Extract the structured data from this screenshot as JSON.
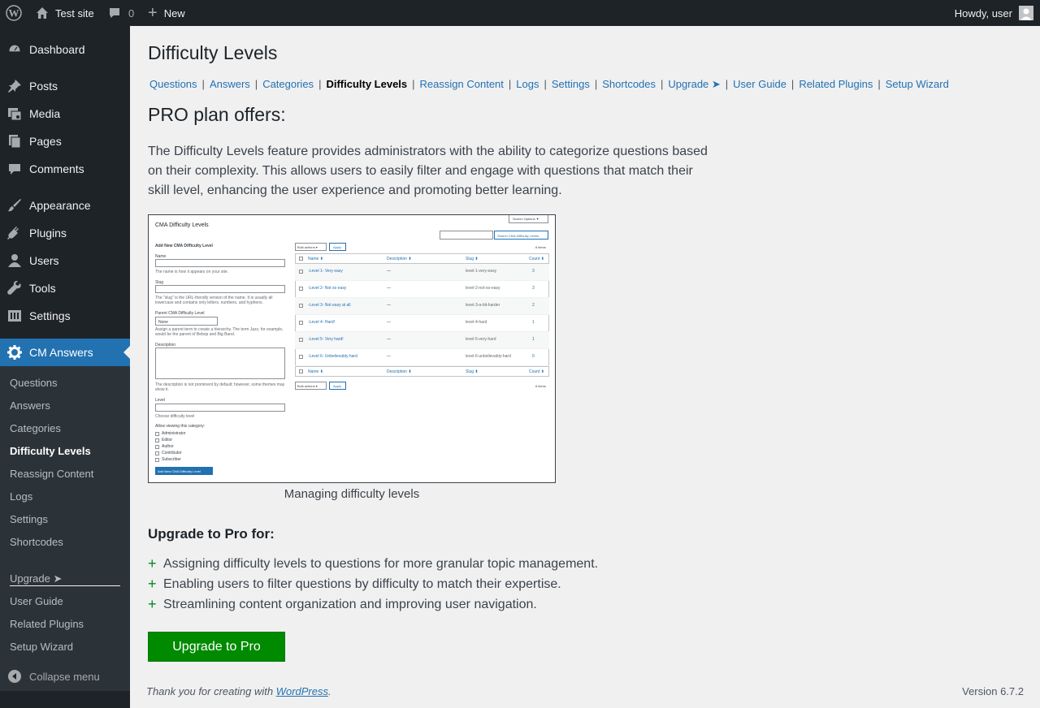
{
  "adminbar": {
    "site_name": "Test site",
    "comments_count": "0",
    "new_label": "New",
    "howdy": "Howdy, user"
  },
  "sidebar": {
    "items": [
      {
        "label": "Dashboard",
        "icon": "dashboard-icon"
      },
      {
        "label": "Posts",
        "icon": "pin-icon"
      },
      {
        "label": "Media",
        "icon": "media-icon"
      },
      {
        "label": "Pages",
        "icon": "pages-icon"
      },
      {
        "label": "Comments",
        "icon": "comment-icon"
      },
      {
        "label": "Appearance",
        "icon": "brush-icon"
      },
      {
        "label": "Plugins",
        "icon": "plug-icon"
      },
      {
        "label": "Users",
        "icon": "user-icon"
      },
      {
        "label": "Tools",
        "icon": "wrench-icon"
      },
      {
        "label": "Settings",
        "icon": "settings-icon"
      },
      {
        "label": "CM Answers",
        "icon": "gear-icon"
      }
    ],
    "submenu": [
      "Questions",
      "Answers",
      "Categories",
      "Difficulty Levels",
      "Reassign Content",
      "Logs",
      "Settings",
      "Shortcodes"
    ],
    "submenu2": [
      "Upgrade ➤",
      "User Guide",
      "Related Plugins",
      "Setup Wizard"
    ],
    "collapse": "Collapse menu"
  },
  "main": {
    "title": "Difficulty Levels",
    "tabs": [
      "Questions",
      "Answers",
      "Categories",
      "Difficulty Levels",
      "Reassign Content",
      "Logs",
      "Settings",
      "Shortcodes",
      "Upgrade ➤",
      "User Guide",
      "Related Plugins",
      "Setup Wizard"
    ],
    "offers_title": "PRO plan offers:",
    "description": "The Difficulty Levels feature provides administrators with the ability to categorize questions based on their complexity. This allows users to easily filter and engage with questions that match their skill level, enhancing the user experience and promoting better learning.",
    "caption": "Managing difficulty levels",
    "upgrade_heading": "Upgrade to Pro for:",
    "features": [
      "Assigning difficulty levels to questions for more granular topic management.",
      "Enabling users to filter questions by difficulty to match their expertise.",
      "Streamlining content organization and improving user navigation."
    ],
    "upgrade_button": "Upgrade to Pro"
  },
  "screenshot": {
    "title": "CMA Difficulty Levels",
    "screen_options": "Screen Options ▼",
    "search_button": "Search CMA Difficulty Levels",
    "add_new_heading": "Add New CMA Difficulty Level",
    "name_label": "Name",
    "name_help": "The name is how it appears on your site.",
    "slug_label": "Slug",
    "slug_help": "The \"slug\" is the URL-friendly version of the name. It is usually all lowercase and contains only letters, numbers, and hyphens.",
    "parent_label": "Parent CMA Difficulty Level",
    "parent_value": "None",
    "parent_help": "Assign a parent term to create a hierarchy. The term Jazz, for example, would be the parent of Bebop and Big Band.",
    "description_label": "Description",
    "description_help": "The description is not prominent by default; however, some themes may show it.",
    "level_label": "Level",
    "level_help": "Choose difficulty level",
    "roles_label": "Allow viewing this category:",
    "roles": [
      "Administrator",
      "Editor",
      "Author",
      "Contributor",
      "Subscriber"
    ],
    "add_button": "Add New CMA Difficulty Level",
    "bulk_actions": "Bulk actions ▾",
    "apply": "Apply",
    "items_count": "6 items",
    "columns": [
      "Name ⬍",
      "Description ⬍",
      "Slug ⬍",
      "Count ⬍"
    ],
    "rows": [
      {
        "name": "-Level 1- Very easy",
        "desc": "—",
        "slug": "level-1-very-easy",
        "count": "3"
      },
      {
        "name": "-Level 2- Not so easy",
        "desc": "—",
        "slug": "level-2-not-so-easy",
        "count": "3"
      },
      {
        "name": "-Level 3- Not easy at all",
        "desc": "—",
        "slug": "level-3-a-bit-harder",
        "count": "2"
      },
      {
        "name": "-Level 4- Hard!",
        "desc": "—",
        "slug": "level-4-hard",
        "count": "1"
      },
      {
        "name": "-Level 5- Very hard!",
        "desc": "—",
        "slug": "level-5-very-hard",
        "count": "1"
      },
      {
        "name": "-Level 6- Unbelievably hard",
        "desc": "—",
        "slug": "level-6-unbelievably-hard",
        "count": "0"
      }
    ]
  },
  "footer": {
    "thanks_prefix": "Thank you for creating with ",
    "thanks_link": "WordPress",
    "thanks_suffix": ".",
    "version": "Version 6.7.2"
  },
  "colors": {
    "adminbar_bg": "#1d2327",
    "menu_current": "#2271b1",
    "link": "#2271b1",
    "upgrade_button": "#008a00"
  }
}
